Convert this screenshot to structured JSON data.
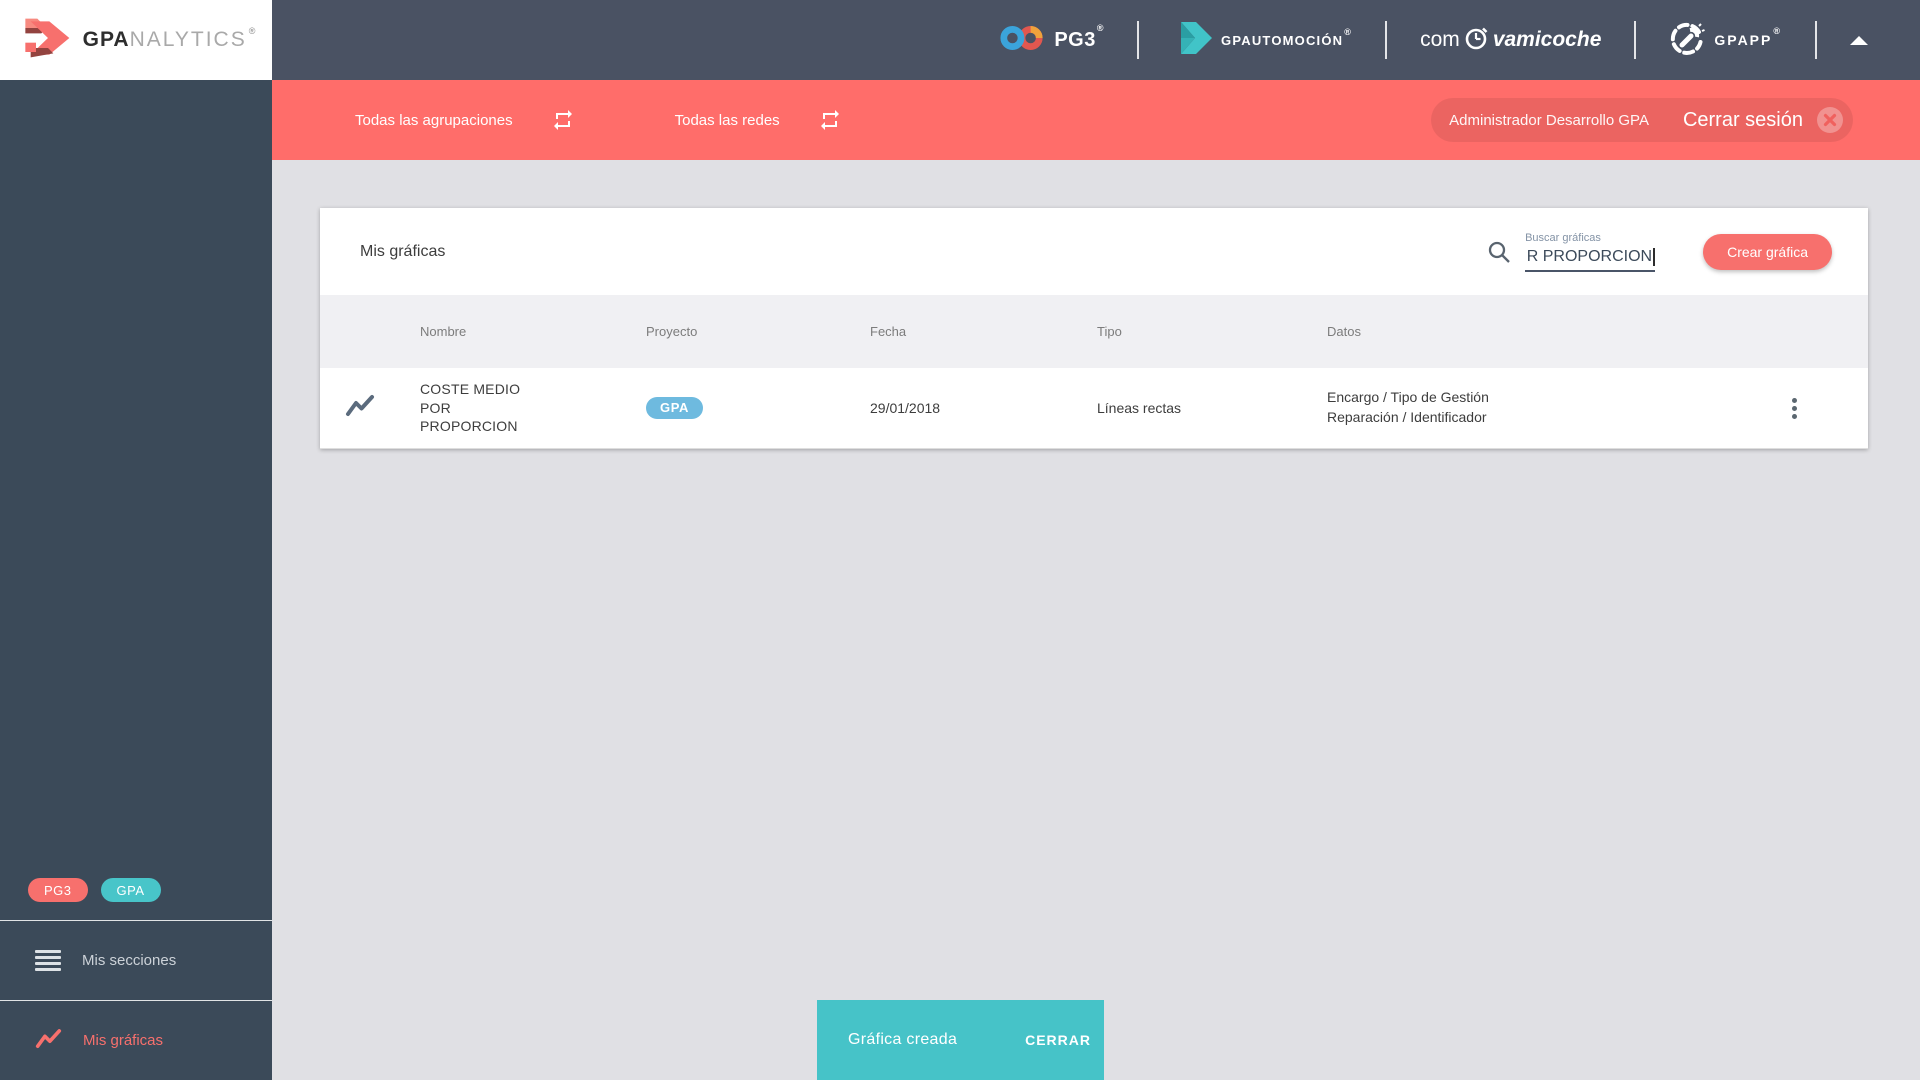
{
  "brand": {
    "gpa": "GPA",
    "nalytics": "NALYTICS",
    "reg": "®"
  },
  "topbar": {
    "pg3": "PG3",
    "pg3_reg": "®",
    "automocion": "GPAUTOMOCIÓN",
    "automocion_reg": "®",
    "com": "com",
    "vamicoche": "vamicoche",
    "gpapp": "GPAPP",
    "gpapp_reg": "®"
  },
  "filterbar": {
    "agrupaciones": "Todas las agrupaciones",
    "redes": "Todas las redes",
    "user": "Administrador Desarrollo GPA",
    "logout": "Cerrar sesión"
  },
  "sidebar": {
    "badges": [
      {
        "label": "PG3"
      },
      {
        "label": "GPA"
      }
    ],
    "items": [
      {
        "label": "Mis secciones"
      },
      {
        "label": "Mis gráficas"
      }
    ]
  },
  "main": {
    "title": "Mis gráficas",
    "search": {
      "label": "Buscar gráficas",
      "value": "R PROPORCION"
    },
    "create_button": "Crear gráfica",
    "table": {
      "headers": [
        "Nombre",
        "Proyecto",
        "Fecha",
        "Tipo",
        "Datos"
      ],
      "rows": [
        {
          "nombre": "COSTE MEDIO POR PROPORCION",
          "proyecto": "GPA",
          "fecha": "29/01/2018",
          "tipo": "Líneas rectas",
          "datos_line1": "Encargo / Tipo de Gestión",
          "datos_line2": "Reparación / Identificador"
        }
      ]
    }
  },
  "toast": {
    "message": "Gráfica creada",
    "action": "CERRAR"
  },
  "colors": {
    "coral": "#ff6d6a",
    "teal": "#46c3c8",
    "header_slate": "#4a5263",
    "sidebar_slate": "#3b4a59",
    "project_badge_blue": "#6ebadf"
  }
}
